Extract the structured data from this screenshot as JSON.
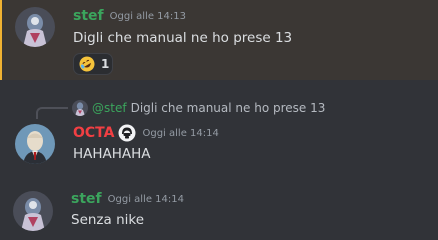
{
  "messages": [
    {
      "author": "stef",
      "author_color": "#3ba55d",
      "timestamp": "Oggi alle 14:13",
      "content": "Digli che manual ne ho prese 13",
      "highlighted": true,
      "reactions": [
        {
          "emoji": "rolling-on-floor-laughing-emoji",
          "count": "1"
        }
      ]
    },
    {
      "author": "OCTA",
      "author_color": "#f23f43",
      "timestamp": "Oggi alle 14:14",
      "content": "HAHAHAHA",
      "role_icon": "helmet-role-icon",
      "reply": {
        "author": "@stef",
        "text": "Digli che manual ne ho prese 13"
      }
    },
    {
      "author": "stef",
      "author_color": "#3ba55d",
      "timestamp": "Oggi alle 14:14",
      "content": "Senza nike"
    }
  ]
}
